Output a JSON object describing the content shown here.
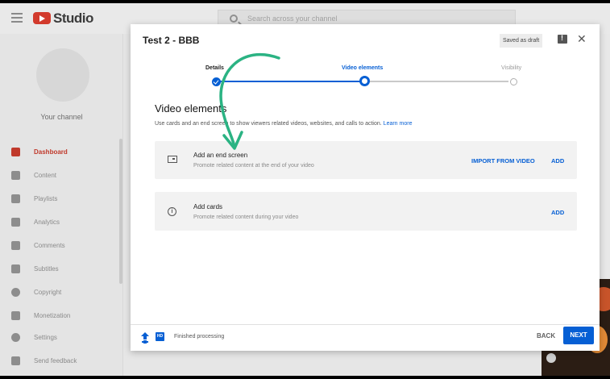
{
  "app": {
    "brand": "Studio",
    "search_placeholder": "Search across your channel"
  },
  "sidebar": {
    "channel_label": "Your channel",
    "items": [
      {
        "label": "Dashboard",
        "icon": "dashboard-icon",
        "active": true
      },
      {
        "label": "Content",
        "icon": "content-icon"
      },
      {
        "label": "Playlists",
        "icon": "playlists-icon"
      },
      {
        "label": "Analytics",
        "icon": "analytics-icon"
      },
      {
        "label": "Comments",
        "icon": "comments-icon"
      },
      {
        "label": "Subtitles",
        "icon": "subtitles-icon"
      },
      {
        "label": "Copyright",
        "icon": "copyright-icon"
      },
      {
        "label": "Monetization",
        "icon": "monetization-icon"
      },
      {
        "label": "Settings",
        "icon": "settings-icon"
      },
      {
        "label": "Send feedback",
        "icon": "feedback-icon"
      }
    ]
  },
  "modal": {
    "title": "Test 2 - BBB",
    "status": "Saved as draft",
    "steps": [
      {
        "label": "Details",
        "state": "done"
      },
      {
        "label": "Video elements",
        "state": "current"
      },
      {
        "label": "Visibility",
        "state": "todo"
      }
    ],
    "section_title": "Video elements",
    "section_desc": "Use cards and an end screen to show viewers related videos, websites, and calls to action.",
    "learn_more": "Learn more",
    "cards": [
      {
        "title": "Add an end screen",
        "subtitle": "Promote related content at the end of your video",
        "import_label": "IMPORT FROM VIDEO",
        "add_label": "ADD"
      },
      {
        "title": "Add cards",
        "subtitle": "Promote related content during your video",
        "add_label": "ADD"
      }
    ],
    "footer": {
      "hd_badge": "HD",
      "processing_text": "Finished processing",
      "back_label": "BACK",
      "next_label": "NEXT"
    }
  },
  "colors": {
    "accent": "#065fd4",
    "brand_red": "#d23a2c",
    "annotation": "#2bb383"
  }
}
